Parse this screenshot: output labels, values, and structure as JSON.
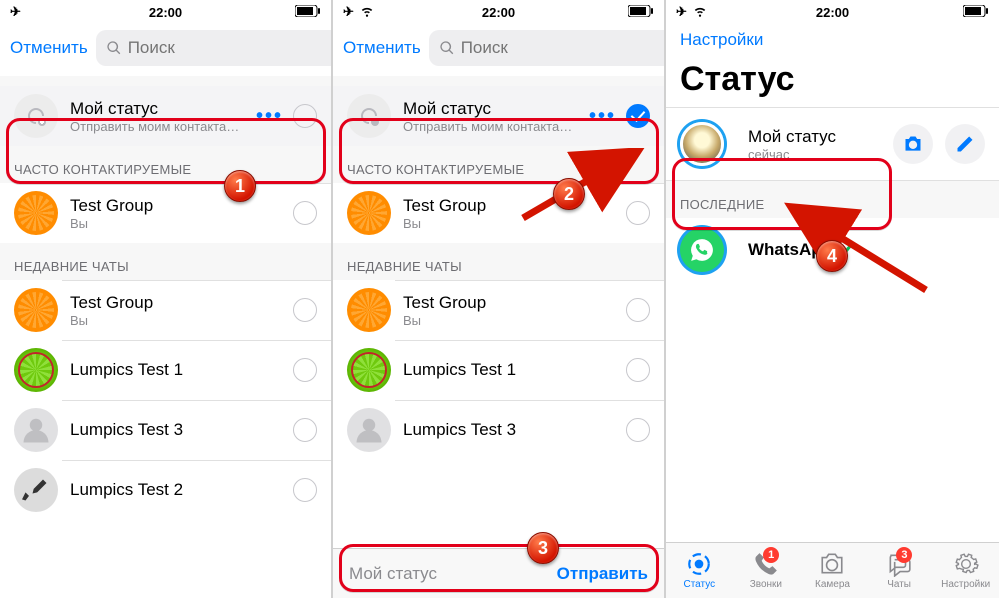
{
  "statusbar": {
    "time": "22:00"
  },
  "panel1": {
    "cancel": "Отменить",
    "search_placeholder": "Поиск",
    "my_status": {
      "title": "Мой статус",
      "subtitle": "Отправить моим контактам, кр…",
      "dots": "•••"
    },
    "section_frequent": "ЧАСТО КОНТАКТИРУЕМЫЕ",
    "section_recent": "НЕДАВНИЕ ЧАТЫ",
    "frequent": [
      {
        "title": "Test Group",
        "subtitle": "Вы"
      }
    ],
    "recent": [
      {
        "title": "Test Group",
        "subtitle": "Вы"
      },
      {
        "title": "Lumpics Test 1",
        "subtitle": ""
      },
      {
        "title": "Lumpics Test 3",
        "subtitle": ""
      },
      {
        "title": "Lumpics Test 2",
        "subtitle": ""
      }
    ]
  },
  "panel2": {
    "cancel": "Отменить",
    "search_placeholder": "Поиск",
    "my_status": {
      "title": "Мой статус",
      "subtitle": "Отправить моим контактам, кр…",
      "dots": "•••"
    },
    "section_frequent": "ЧАСТО КОНТАКТИРУЕМЫЕ",
    "section_recent": "НЕДАВНИЕ ЧАТЫ",
    "frequent": [
      {
        "title": "Test Group",
        "subtitle": "Вы"
      }
    ],
    "recent": [
      {
        "title": "Test Group",
        "subtitle": "Вы"
      },
      {
        "title": "Lumpics Test 1",
        "subtitle": ""
      },
      {
        "title": "Lumpics Test 3",
        "subtitle": ""
      }
    ],
    "sendbar": {
      "label": "Мой статус",
      "button": "Отправить"
    }
  },
  "panel3": {
    "back": "Настройки",
    "title": "Статус",
    "my_status": {
      "title": "Мой статус",
      "subtitle": "сейчас"
    },
    "section_recent": "ПОСЛЕДНИЕ",
    "recent_item": {
      "title": "WhatsApp"
    },
    "tabs": {
      "status": "Статус",
      "calls": "Звонки",
      "camera": "Камера",
      "chats": "Чаты",
      "settings": "Настройки",
      "calls_badge": "1",
      "chats_badge": "3"
    }
  },
  "callouts": {
    "n1": "1",
    "n2": "2",
    "n3": "3",
    "n4": "4"
  }
}
